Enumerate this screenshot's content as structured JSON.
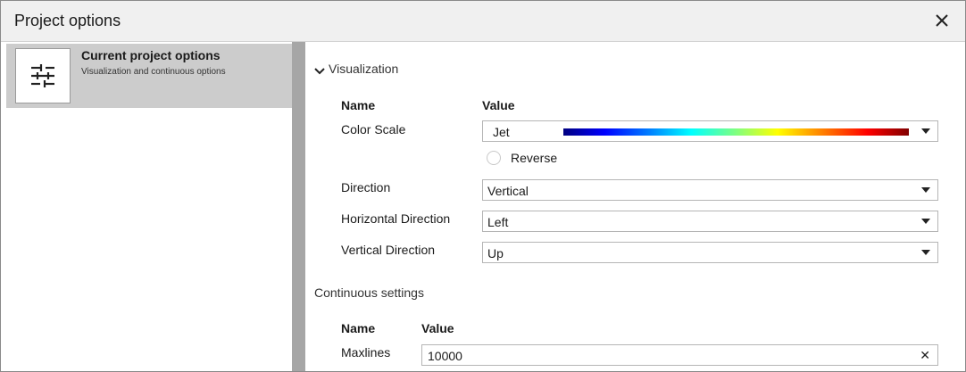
{
  "window": {
    "title": "Project options"
  },
  "sidebar": {
    "items": [
      {
        "title": "Current project options",
        "subtitle": "Visualization and continuous options",
        "icon": "sliders-icon",
        "selected": true
      }
    ]
  },
  "visualization": {
    "section_label": "Visualization",
    "expanded": true,
    "header_name": "Name",
    "header_value": "Value",
    "color_scale": {
      "label": "Color Scale",
      "value": "Jet",
      "reverse_label": "Reverse",
      "reverse_checked": false
    },
    "direction": {
      "label": "Direction",
      "value": "Vertical"
    },
    "horizontal_direction": {
      "label": "Horizontal Direction",
      "value": "Left"
    },
    "vertical_direction": {
      "label": "Vertical Direction",
      "value": "Up"
    }
  },
  "continuous": {
    "section_label": "Continuous settings",
    "header_name": "Name",
    "header_value": "Value",
    "maxlines": {
      "label": "Maxlines",
      "value": "10000"
    }
  },
  "colors": {
    "selected_bg": "#cccccc",
    "splitter": "#a6a6a6",
    "titlebar": "#f0f0f0"
  }
}
